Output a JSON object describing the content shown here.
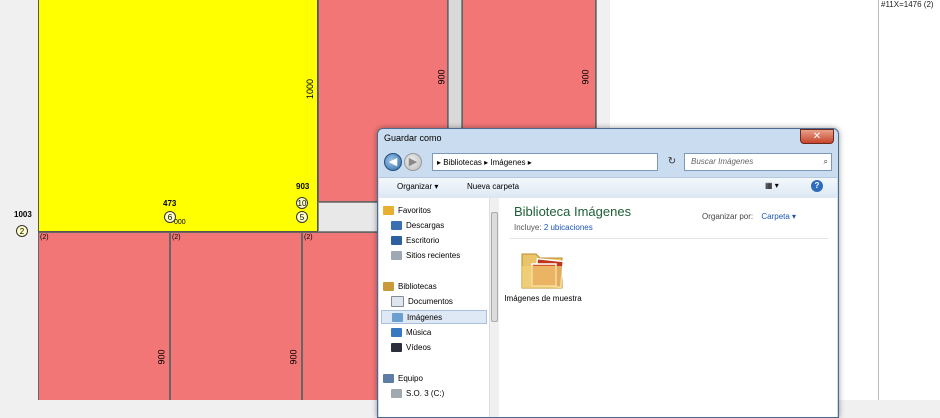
{
  "drawing": {
    "right_pane_text": "#11X=1476 (2)",
    "dims": [
      "1000",
      "900",
      "900",
      "900",
      "900"
    ],
    "labels": [
      "1003",
      "473",
      "903",
      "000"
    ],
    "markers": [
      "2",
      "6",
      "10",
      "5"
    ],
    "small_marks": [
      "(2)",
      "(2)",
      "(2)"
    ]
  },
  "dialog": {
    "title": "Guardar como",
    "close": "✕",
    "address": "▸ Bibliotecas ▸ Imágenes ▸",
    "search_placeholder": "Buscar Imágenes",
    "toolbar": {
      "organize": "Organizar ▾",
      "new_folder": "Nueva carpeta"
    },
    "sidebar": {
      "favorites": "Favoritos",
      "descargas": "Descargas",
      "escritorio": "Escritorio",
      "recientes": "Sitios recientes",
      "bibliotecas": "Bibliotecas",
      "documentos": "Documentos",
      "imagenes": "Imágenes",
      "musica": "Música",
      "videos": "Vídeos",
      "equipo": "Equipo",
      "so3": "S.O. 3 (C:)"
    },
    "main": {
      "title": "Biblioteca Imágenes",
      "includes_label": "Incluye:",
      "includes_link": "2 ubicaciones",
      "org_by_label": "Organizar por:",
      "org_by_value": "Carpeta ▾",
      "folder_name": "Imágenes de muestra"
    }
  },
  "colors": {
    "panel": "#f27676",
    "highlight": "#ffff00",
    "dialog_frame": "#c9dcf0"
  }
}
